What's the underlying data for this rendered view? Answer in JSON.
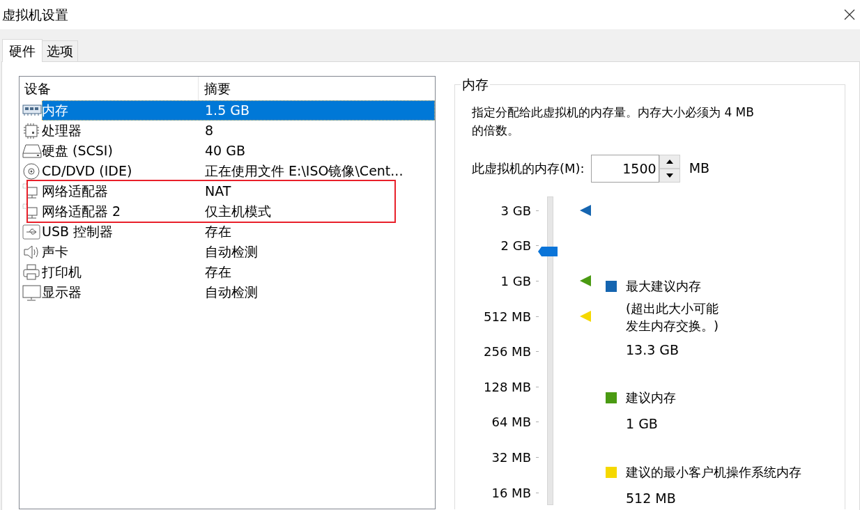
{
  "window": {
    "title": "虚拟机设置"
  },
  "tabs": [
    {
      "label": "硬件",
      "selected": true
    },
    {
      "label": "选项",
      "selected": false
    }
  ],
  "device_list": {
    "columns": [
      "设备",
      "摘要"
    ],
    "rows": [
      {
        "kind": "memory",
        "device": "内存",
        "summary": "1.5 GB",
        "selected": true,
        "annotated": false
      },
      {
        "kind": "processor",
        "device": "处理器",
        "summary": "8",
        "selected": false,
        "annotated": false
      },
      {
        "kind": "disk",
        "device": "硬盘 (SCSI)",
        "summary": "40 GB",
        "selected": false,
        "annotated": false
      },
      {
        "kind": "cdrom",
        "device": "CD/DVD (IDE)",
        "summary": "正在使用文件 E:\\ISO镜像\\Cent...",
        "selected": false,
        "annotated": false
      },
      {
        "kind": "network",
        "device": "网络适配器",
        "summary": "NAT",
        "selected": false,
        "annotated": true
      },
      {
        "kind": "network",
        "device": "网络适配器 2",
        "summary": "仅主机模式",
        "selected": false,
        "annotated": true
      },
      {
        "kind": "usb",
        "device": "USB 控制器",
        "summary": "存在",
        "selected": false,
        "annotated": false
      },
      {
        "kind": "sound",
        "device": "声卡",
        "summary": "自动检测",
        "selected": false,
        "annotated": false
      },
      {
        "kind": "printer",
        "device": "打印机",
        "summary": "存在",
        "selected": false,
        "annotated": false
      },
      {
        "kind": "display",
        "device": "显示器",
        "summary": "自动检测",
        "selected": false,
        "annotated": false
      }
    ]
  },
  "memory_group": {
    "title": "内存",
    "description": "指定分配给此虚拟机的内存量。内存大小必须为 4 MB\n的倍数。",
    "field_label": "此虚拟机的内存(M):",
    "value": "1500",
    "unit": "MB",
    "slider": {
      "level": 0.82,
      "ticks": [
        {
          "label": "3 GB",
          "color": "#1565b0"
        },
        {
          "label": "2 GB"
        },
        {
          "label": "1 GB",
          "color": "#4a9a12"
        },
        {
          "label": "512 MB",
          "color": "#f5d800"
        },
        {
          "label": "256 MB"
        },
        {
          "label": "128 MB"
        },
        {
          "label": "64 MB"
        },
        {
          "label": "32 MB"
        },
        {
          "label": "16 MB"
        }
      ]
    },
    "legend": [
      {
        "color": "#1565b0",
        "title": "最大建议内存",
        "note": "(超出此大小可能发生内存交换。)",
        "value": "13.3 GB"
      },
      {
        "color": "#4a9a12",
        "title": "建议内存",
        "value": "1 GB"
      },
      {
        "color": "#f5d800",
        "title": "建议的最小客户机操作系统内存",
        "value": "512 MB"
      }
    ]
  }
}
